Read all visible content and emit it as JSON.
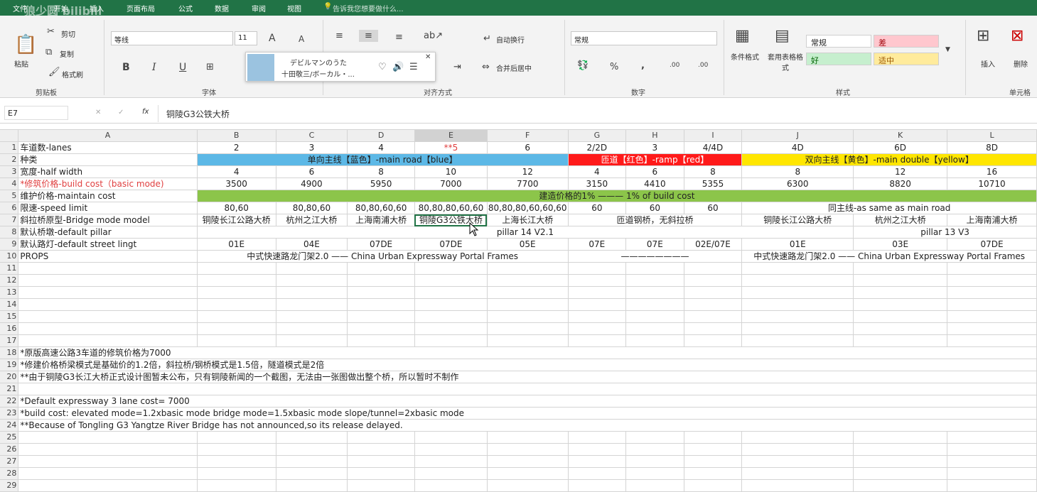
{
  "watermark": "狼少圆 bilibili",
  "tabs": [
    "文件",
    "开始",
    "插入",
    "页面布局",
    "公式",
    "数据",
    "审阅",
    "视图"
  ],
  "tell_me": "告诉我您想要做什么...",
  "ribbon": {
    "clipboard": {
      "paste": "粘贴",
      "cut": "剪切",
      "copy": "复制",
      "format_painter": "格式刷",
      "label": "剪贴板"
    },
    "font": {
      "name": "等线",
      "size": "11",
      "bold": "B",
      "italic": "I",
      "underline": "U",
      "grow": "A",
      "shrink": "A",
      "label": "字体"
    },
    "music": {
      "title": "デビルマンのうた",
      "artist": "十田敬三/ボーカル・..."
    },
    "align": {
      "wrap": "自动换行",
      "merge": "合并后居中",
      "label": "对齐方式"
    },
    "number": {
      "format": "常规",
      "percent": "%",
      "comma": ",",
      "inc": ".00",
      "label": "数字"
    },
    "styles": {
      "cond": "条件格式",
      "table": "套用表格格式",
      "normal": "常规",
      "bad": "差",
      "good": "好",
      "neutral": "适中",
      "label": "样式"
    },
    "cells": {
      "insert": "插入",
      "delete": "删除",
      "label": "单元格"
    }
  },
  "formula": {
    "namebox": "E7",
    "fx": "fx",
    "content": "铜陵G3公铁大桥"
  },
  "columns": [
    "",
    "A",
    "B",
    "C",
    "D",
    "E",
    "F",
    "G",
    "H",
    "I",
    "J",
    "K",
    "L"
  ],
  "rows": {
    "r1": {
      "a": "车道数-lanes",
      "b": "2",
      "c": "3",
      "d": "4",
      "e": "**5",
      "f": "6",
      "g": "2/2D",
      "h": "3",
      "i": "4/4D",
      "j": "4D",
      "k": "6D",
      "l": "8D"
    },
    "r2": {
      "a": "种类",
      "blue": "单向主线【蓝色】-main road【blue】",
      "red": "匝道【红色】-ramp【red】",
      "yellow": "双向主线【黄色】-main double【yellow】"
    },
    "r3": {
      "a": "宽度-half width",
      "b": "4",
      "c": "6",
      "d": "8",
      "e": "10",
      "f": "12",
      "g": "4",
      "h": "6",
      "i": "8",
      "j": "8",
      "k": "12",
      "l": "16"
    },
    "r4": {
      "a": "*修筑价格-build cost（basic mode)",
      "b": "3500",
      "c": "4900",
      "d": "5950",
      "e": "7000",
      "f": "7700",
      "g": "3150",
      "h": "4410",
      "i": "5355",
      "j": "6300",
      "k": "8820",
      "l": "10710"
    },
    "r5": {
      "a": "维护价格-maintain cost",
      "merged": "建造价格的1% ——— 1% of build cost"
    },
    "r6": {
      "a": "限速-speed limit",
      "b": "80,60",
      "c": "80,80,60",
      "d": "80,80,60,60",
      "e": "80,80,80,60,60",
      "f": "80,80,80,60,60,60",
      "g": "60",
      "h": "60",
      "i": "60",
      "jl": "同主线-as same as main road"
    },
    "r7": {
      "a": "斜拉桥原型-Bridge mode model",
      "b": "铜陵长江公路大桥",
      "c": "杭州之江大桥",
      "d": "上海南浦大桥",
      "e": "铜陵G3公铁大桥",
      "f": "上海长江大桥",
      "gi": "匝道钢桥，无斜拉桥",
      "j": "铜陵长江公路大桥",
      "k": "杭州之江大桥",
      "l": "上海南浦大桥"
    },
    "r8": {
      "a": "默认桥墩-default pillar",
      "mid": "pillar 14 V2.1",
      "right": "pillar 13 V3"
    },
    "r9": {
      "a": "默认路灯-default street lingt",
      "b": "01E",
      "c": "04E",
      "d": "07DE",
      "e": "07DE",
      "f": "05E",
      "g": "07E",
      "h": "07E",
      "i": "02E/07E",
      "j": "01E",
      "k": "03E",
      "l": "07DE"
    },
    "r10": {
      "a": "PROPS",
      "bf": "中式快速路龙门架2.0 —— China Urban Expressway Portal Frames",
      "gi": "————————",
      "jl": "中式快速路龙门架2.0 —— China Urban Expressway Portal Frames"
    },
    "r18": "*原版高速公路3车道的修筑价格为7000",
    "r19": "*修建价格桥梁模式是基础价的1.2倍，斜拉桥/钢桥模式是1.5倍，隧道模式是2倍",
    "r20": "**由于铜陵G3长江大桥正式设计图暂未公布，只有铜陵新闻的一个截图，无法由一张图做出整个桥，所以暂时不制作",
    "r22": "*Default expressway 3 lane cost= 7000",
    "r23": "*build cost:   elevated mode=1.2xbasic mode   bridge mode=1.5xbasic mode   slope/tunnel=2xbasic mode",
    "r24": "**Because of Tongling G3 Yangtze River Bridge has not announced,so its release delayed."
  },
  "row_numbers": [
    "1",
    "2",
    "3",
    "4",
    "5",
    "6",
    "7",
    "8",
    "9",
    "10",
    "11",
    "12",
    "13",
    "14",
    "15",
    "16",
    "17",
    "18",
    "19",
    "20",
    "21",
    "22",
    "23",
    "24",
    "25",
    "26",
    "27",
    "28",
    "29"
  ]
}
